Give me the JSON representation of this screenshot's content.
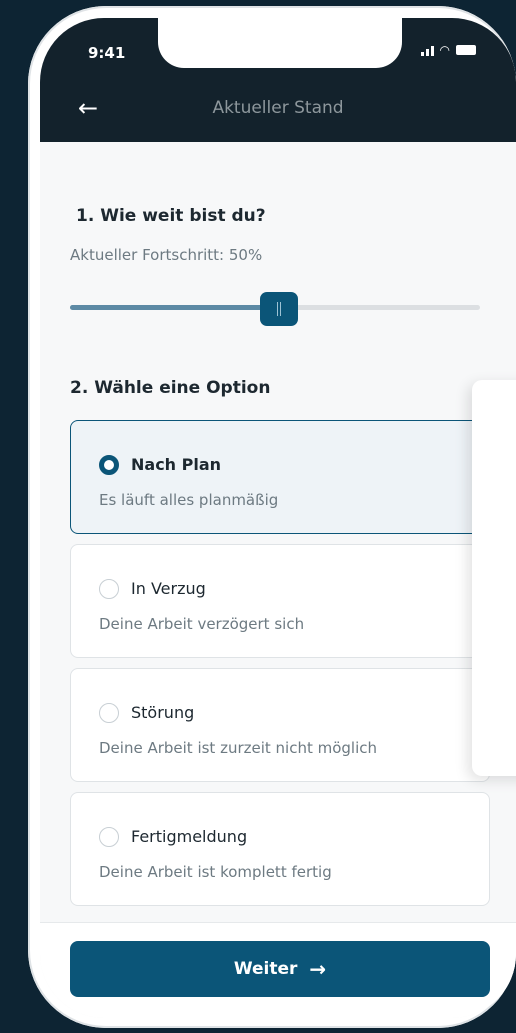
{
  "status_bar": {
    "time": "9:41"
  },
  "header": {
    "title": "Aktueller Stand",
    "back_icon": "arrow-left-icon"
  },
  "progress": {
    "question": "1. Wie weit bist du?",
    "label": "Aktueller Fortschritt: 50%",
    "value": 0.5
  },
  "options": {
    "question": "2. Wähle eine Option",
    "items": [
      {
        "title": "Nach Plan",
        "subtitle": "Es läuft alles planmäßig",
        "selected": true
      },
      {
        "title": "In Verzug",
        "subtitle": "Deine Arbeit verzögert sich",
        "selected": false
      },
      {
        "title": "Störung",
        "subtitle": "Deine Arbeit ist zurzeit nicht möglich",
        "selected": false
      },
      {
        "title": "Fertigmeldung",
        "subtitle": "Deine Arbeit ist komplett fertig",
        "selected": false
      }
    ]
  },
  "footer": {
    "next_label": "Weiter",
    "next_icon": "arrow-right-icon"
  },
  "colors": {
    "accent": "#0b5578",
    "header_bg": "#13222c",
    "slider_fill": "#5d8aa5"
  }
}
